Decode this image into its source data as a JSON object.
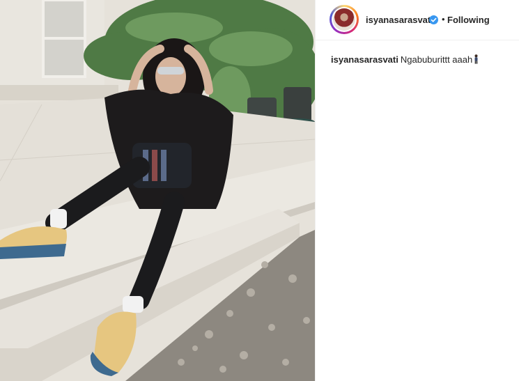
{
  "post": {
    "image_alt": "Woman in black outfit and sunglasses sitting on white stone steps beside potted plants and pebbles"
  },
  "header": {
    "username": "isyanasarasvati",
    "separator": "•",
    "follow_label": "Following"
  },
  "caption": {
    "username": "isyanasarasvati",
    "text": "Ngabuburittt aaah",
    "emoji": "person-standing-icon"
  },
  "colors": {
    "verified_badge": "#3897f0",
    "text": "#262626",
    "divider": "#efefef"
  }
}
